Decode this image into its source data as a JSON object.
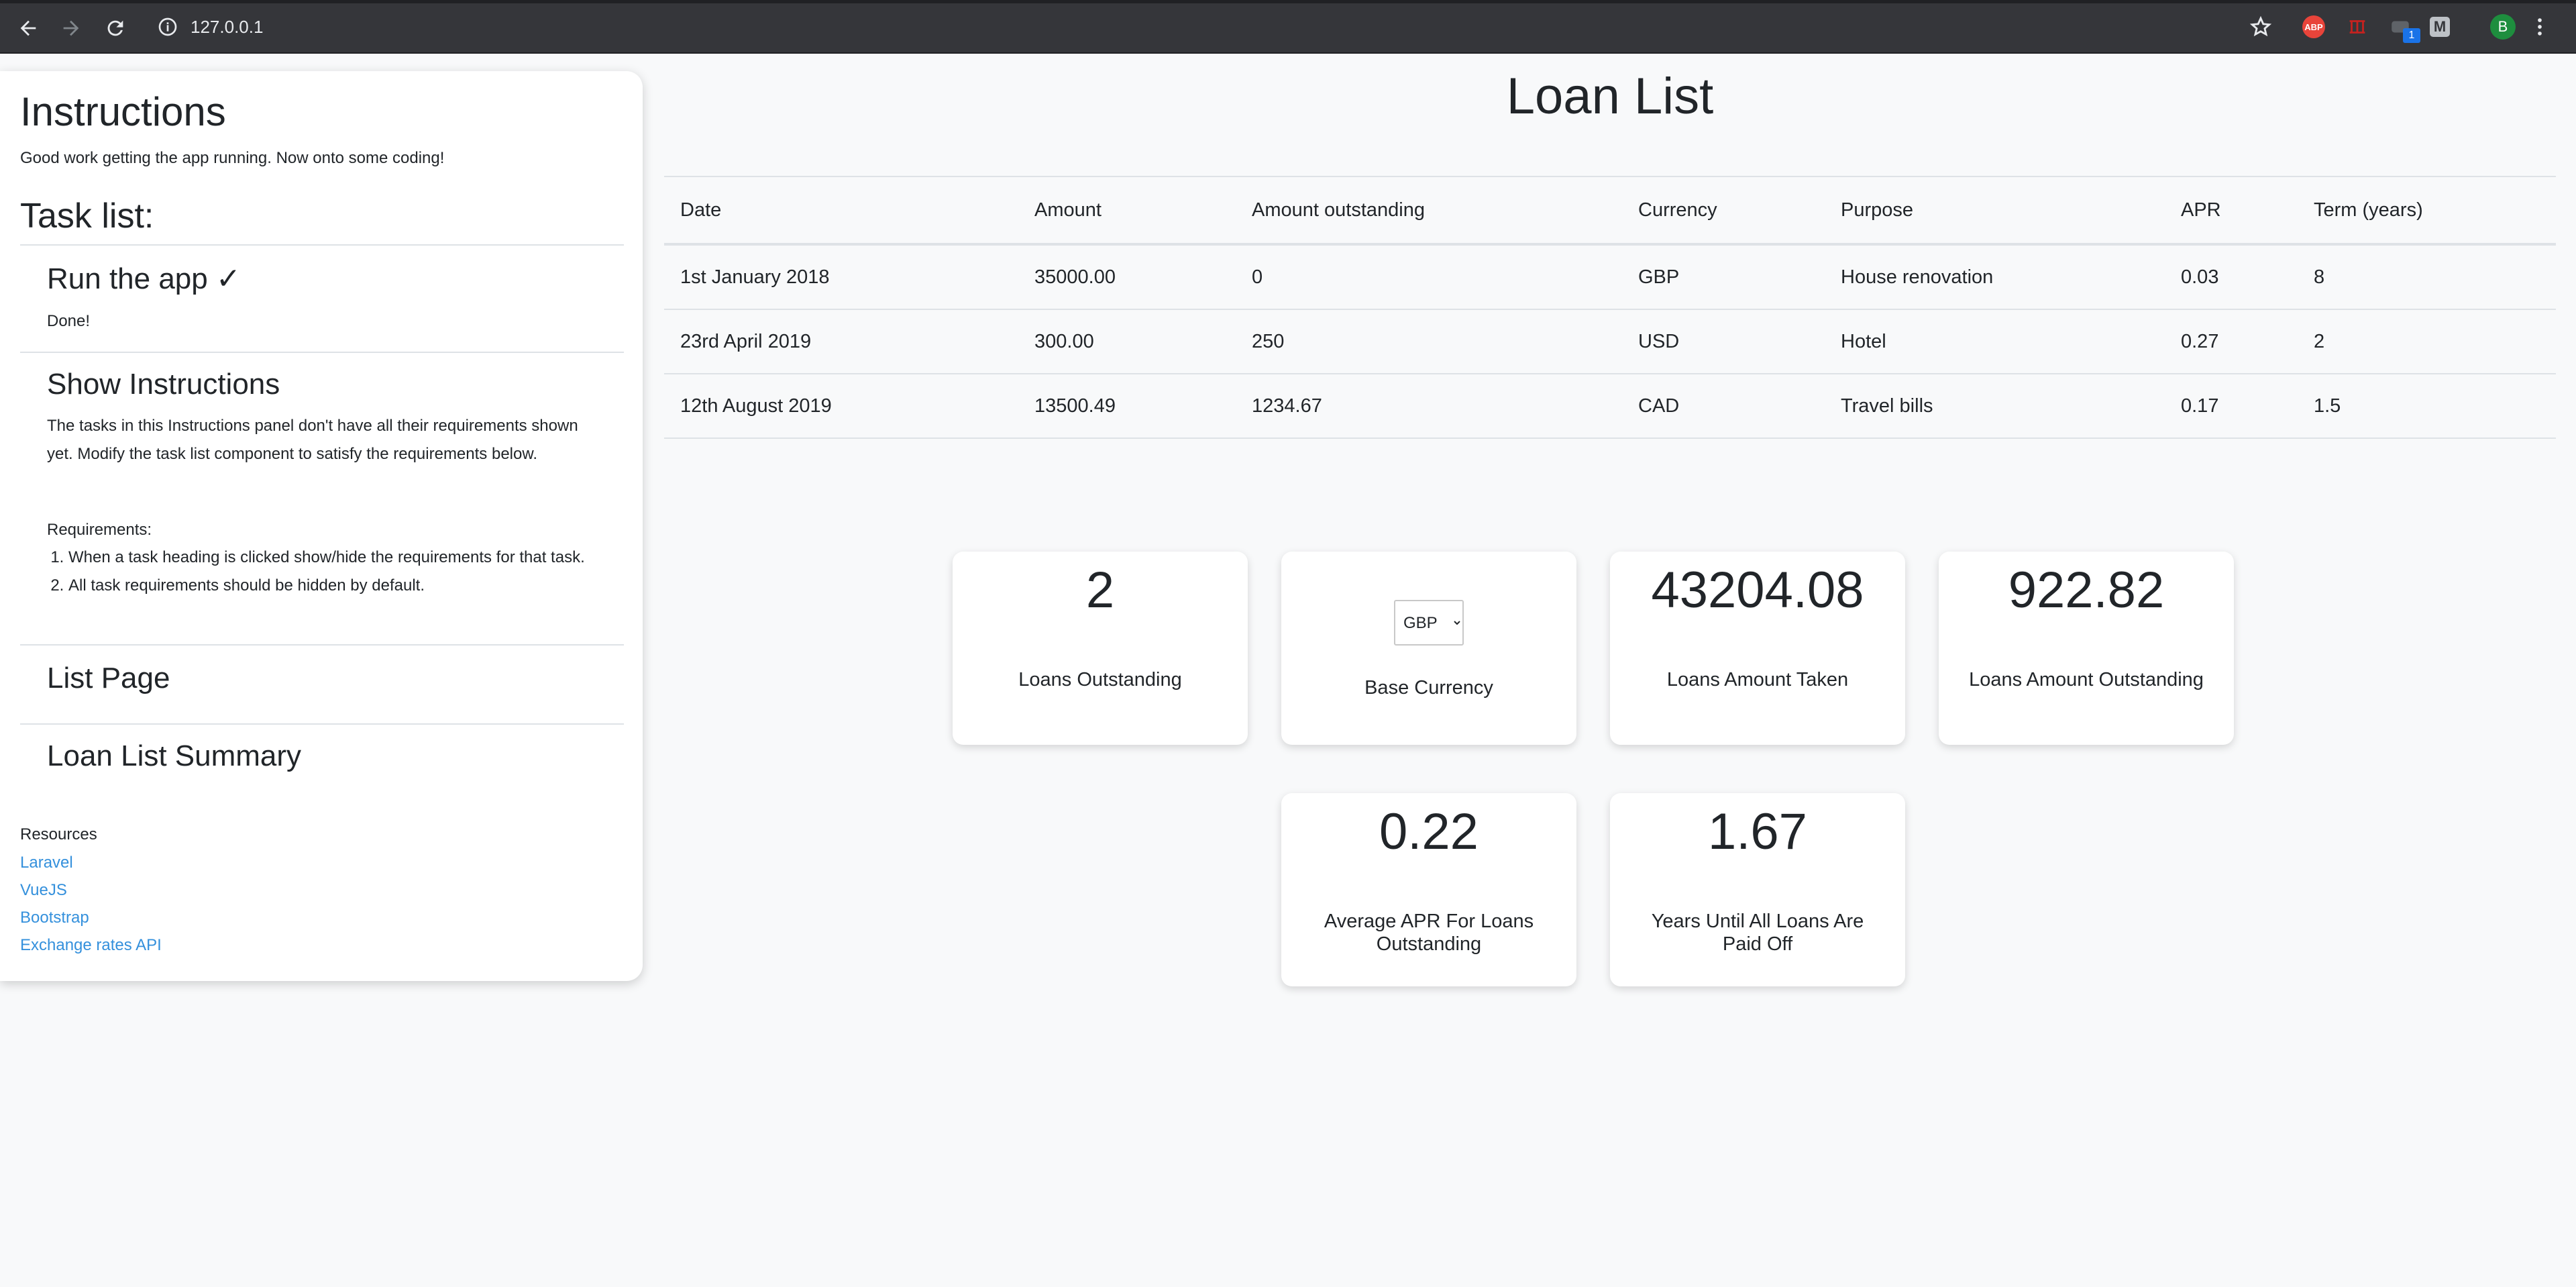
{
  "browser": {
    "url": "127.0.0.1",
    "avatar_initial": "B",
    "abp_label": "ABP",
    "m_label": "M",
    "badge_count": "1"
  },
  "instructions": {
    "title": "Instructions",
    "intro": "Good work getting the app running. Now onto some coding!",
    "task_list_heading": "Task list:",
    "tasks": [
      {
        "title": "Run the app ✓",
        "text": "Done!"
      },
      {
        "title": "Show Instructions",
        "text": "The tasks in this Instructions panel don't have all their requirements shown yet. Modify the task list component to satisfy the requirements below.",
        "requirements_label": "Requirements:",
        "requirements": [
          "When a task heading is clicked show/hide the requirements for that task.",
          "All task requirements should be hidden by default."
        ]
      },
      {
        "title": "List Page"
      },
      {
        "title": "Loan List Summary"
      }
    ],
    "resources_label": "Resources",
    "resources": [
      "Laravel",
      "VueJS",
      "Bootstrap",
      "Exchange rates API"
    ]
  },
  "main": {
    "title": "Loan List",
    "columns": [
      "Date",
      "Amount",
      "Amount outstanding",
      "Currency",
      "Purpose",
      "APR",
      "Term (years)"
    ],
    "rows": [
      [
        "1st January 2018",
        "35000.00",
        "0",
        "GBP",
        "House renovation",
        "0.03",
        "8"
      ],
      [
        "23rd April 2019",
        "300.00",
        "250",
        "USD",
        "Hotel",
        "0.27",
        "2"
      ],
      [
        "12th August 2019",
        "13500.49",
        "1234.67",
        "CAD",
        "Travel bills",
        "0.17",
        "1.5"
      ]
    ]
  },
  "summary": {
    "loans_outstanding": {
      "value": "2",
      "label": "Loans Outstanding"
    },
    "base_currency": {
      "selected": "GBP",
      "label": "Base Currency"
    },
    "amount_taken": {
      "value": "43204.08",
      "label": "Loans Amount Taken"
    },
    "amount_outstanding": {
      "value": "922.82",
      "label": "Loans Amount Outstanding"
    },
    "average_apr": {
      "value": "0.22",
      "label": "Average APR For Loans Outstanding"
    },
    "years_until_paid": {
      "value": "1.67",
      "label": "Years Until All Loans Are Paid Off"
    }
  }
}
